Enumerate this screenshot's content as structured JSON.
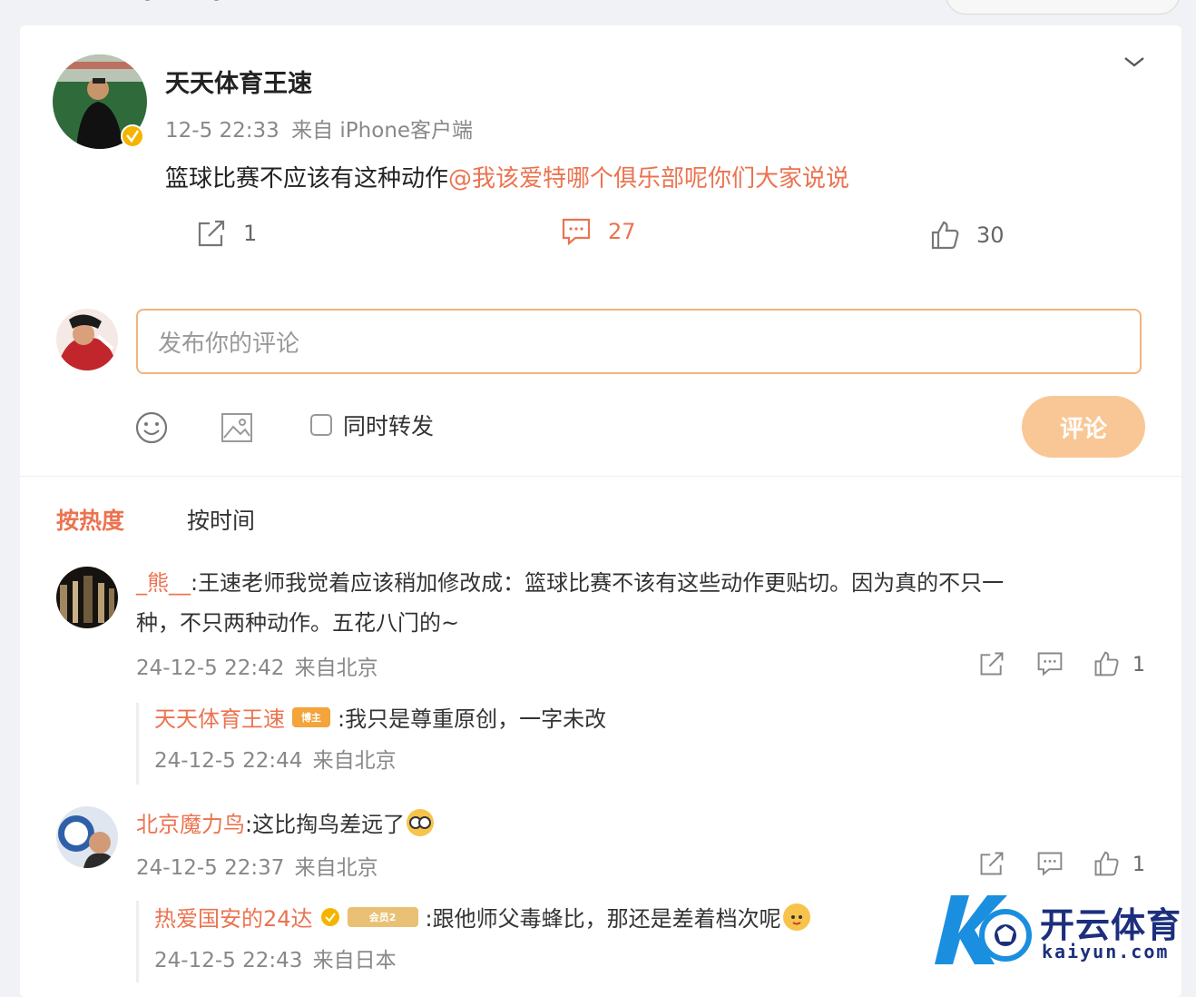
{
  "post": {
    "author": "天天体育王速",
    "time": "12-5 22:33",
    "source": "来自 iPhone客户端",
    "text": "篮球比赛不应该有这种动作",
    "mention": "@我该爱特哪个俱乐部呢你们大家说说",
    "reposts": "1",
    "comments": "27",
    "likes": "30"
  },
  "composer": {
    "placeholder": "发布你的评论",
    "forward_label": "同时转发",
    "submit_label": "评论"
  },
  "sort_tabs": [
    "按热度",
    "按时间"
  ],
  "comments": [
    {
      "user": "_熊__",
      "text_line1": ":王速老师我觉着应该稍加修改成：篮球比赛不该有这些动作更贴切。因为真的不只一",
      "text_line2": "种，不只两种动作。五花八门的~",
      "time": "24-12-5 22:42",
      "location": "来自北京",
      "likes": "1",
      "reply": {
        "user": "天天体育王速",
        "badge": "博主",
        "text": ":我只是尊重原创，一字未改",
        "time": "24-12-5 22:44",
        "location": "来自北京"
      }
    },
    {
      "user": "北京魔力鸟",
      "text": ":这比掏鸟差远了",
      "time": "24-12-5 22:37",
      "location": "来自北京",
      "likes": "1",
      "reply": {
        "user": "热爱国安的24达",
        "badge": "会员2",
        "text": ":跟他师父毒蜂比，那还是差着档次呢",
        "time": "24-12-5 22:43",
        "location": "来自日本"
      }
    }
  ],
  "watermark": {
    "name": "开云体育",
    "domain": "kaiyun.com"
  },
  "colors": {
    "accent": "#eb7350",
    "input_border": "#f0b57a",
    "submit_bg": "#f9c795",
    "watermark_blue": "#1c2f7c"
  }
}
